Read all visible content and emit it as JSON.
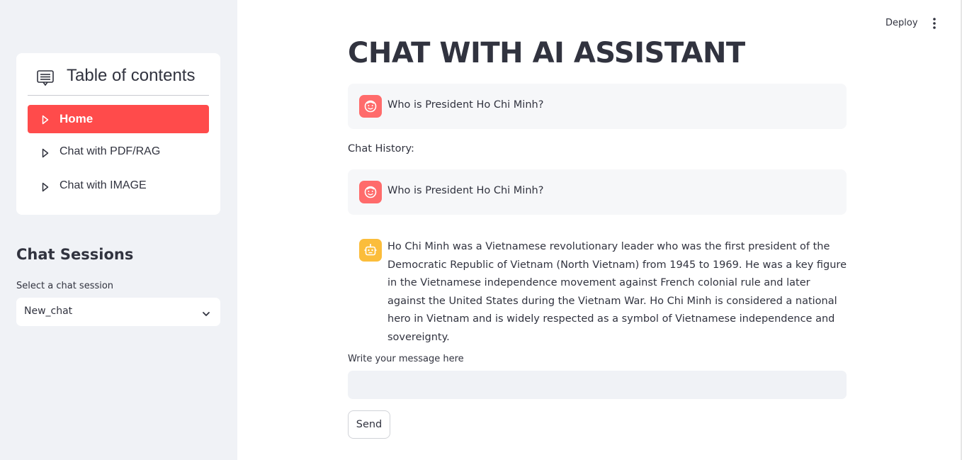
{
  "header": {
    "deploy_label": "Deploy",
    "more_icon": "more-vertical-icon"
  },
  "sidebar": {
    "toc_title": "Table of contents",
    "toc_icon": "list-document-icon",
    "items": [
      {
        "label": "Home",
        "active": true,
        "icon": "play-triangle-icon"
      },
      {
        "label": "Chat with PDF/RAG",
        "active": false,
        "icon": "play-triangle-icon"
      },
      {
        "label": "Chat with IMAGE",
        "active": false,
        "icon": "play-triangle-icon"
      }
    ],
    "sessions_title": "Chat Sessions",
    "select_label": "Select a chat session",
    "select_value": "New_chat"
  },
  "main": {
    "title": "CHAT WITH AI ASSISTANT",
    "current_user_message": "Who is President Ho Chi Minh?",
    "history_label": "Chat History:",
    "history": [
      {
        "role": "user",
        "text": "Who is President Ho Chi Minh?"
      },
      {
        "role": "assistant",
        "text": "Ho Chi Minh was a Vietnamese revolutionary leader who was the first president of the Democratic Republic of Vietnam (North Vietnam) from 1945 to 1969. He was a key figure in the Vietnamese independence movement against French colonial rule and later against the United States during the Vietnam War. Ho Chi Minh is considered a national hero in Vietnam and is widely respected as a symbol of Vietnamese independence and sovereignty."
      }
    ],
    "input_label": "Write your message here",
    "input_value": "",
    "send_label": "Send"
  },
  "colors": {
    "accent": "#ff4b4b",
    "sidebar_bg": "#f0f2f6",
    "user_avatar": "#ff6b6b",
    "bot_avatar": "#fbbd3b",
    "text": "#31333f"
  }
}
